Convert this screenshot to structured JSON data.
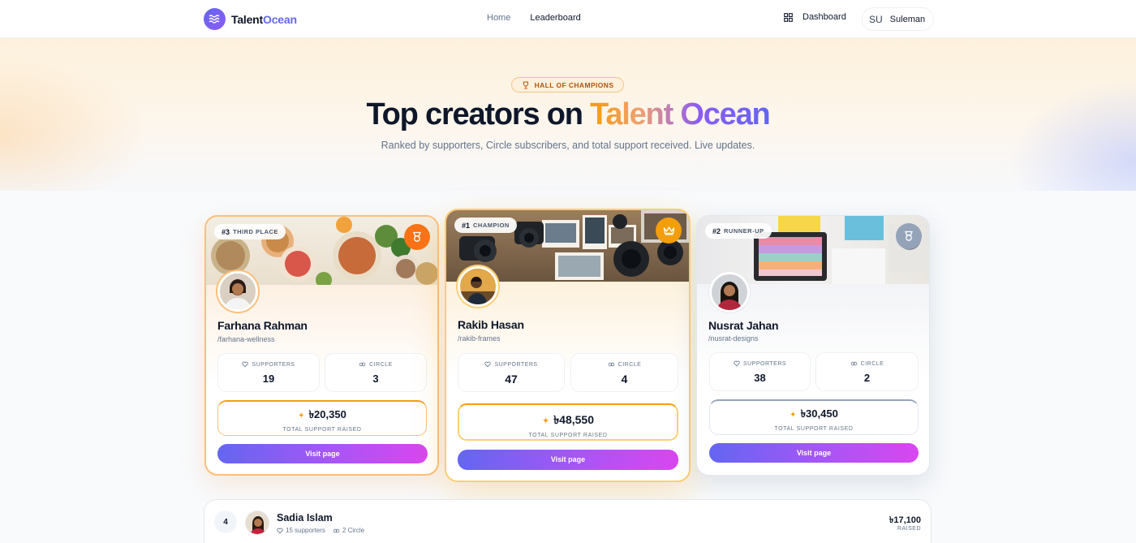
{
  "brand": {
    "name_main": "Talent",
    "name_accent": "Ocean"
  },
  "nav": {
    "home": "Home",
    "leaderboard": "Leaderboard"
  },
  "header": {
    "dashboard": "Dashboard",
    "user_initials": "SU",
    "user_name": "Suleman"
  },
  "hero": {
    "badge": "HALL OF CHAMPIONS",
    "title_main": "Top creators on ",
    "title_accent": "Talent Ocean",
    "subtitle": "Ranked by supporters, Circle subscribers, and total support received. Live updates."
  },
  "labels": {
    "supporters": "SUPPORTERS",
    "circle": "CIRCLE",
    "raised": "TOTAL SUPPORT RAISED",
    "visit": "Visit page"
  },
  "podium": {
    "third": {
      "rank": "#3",
      "rank_label": "THIRD PLACE",
      "name": "Farhana Rahman",
      "handle": "/farhana-wellness",
      "supporters": "19",
      "circle": "3",
      "raised": "৳20,350"
    },
    "first": {
      "rank": "#1",
      "rank_label": "CHAMPION",
      "name": "Rakib Hasan",
      "handle": "/rakib-frames",
      "supporters": "47",
      "circle": "4",
      "raised": "৳48,550"
    },
    "second": {
      "rank": "#2",
      "rank_label": "RUNNER-UP",
      "name": "Nusrat Jahan",
      "handle": "/nusrat-designs",
      "supporters": "38",
      "circle": "2",
      "raised": "৳30,450"
    }
  },
  "list": [
    {
      "rank": "4",
      "name": "Sadia Islam",
      "supporters": "15 supporters",
      "circle": "2 Circle",
      "amount": "৳17,100",
      "amount_label": "RAISED"
    }
  ],
  "colors": {
    "accent": "#6366f1",
    "gold": "#f59e0b",
    "bronze": "#f97316",
    "silver": "#94a3b8"
  }
}
